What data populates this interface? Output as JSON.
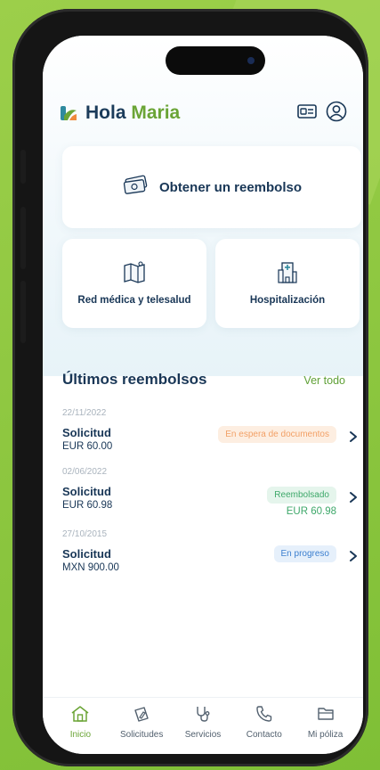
{
  "header": {
    "greeting": "Hola",
    "name": "Maria"
  },
  "actions": {
    "main": "Obtener un reembolso",
    "medical_network": "Red médica y telesalud",
    "hospitalization": "Hospitalización"
  },
  "reimbursements": {
    "title": "Últimos reembolsos",
    "see_all": "Ver todo",
    "items": [
      {
        "date": "22/11/2022",
        "title": "Solicitud",
        "amount": "EUR 60.00",
        "status": "En espera de documentos",
        "refund": ""
      },
      {
        "date": "02/06/2022",
        "title": "Solicitud",
        "amount": "EUR 60.98",
        "status": "Reembolsado",
        "refund": "EUR 60.98"
      },
      {
        "date": "27/10/2015",
        "title": "Solicitud",
        "amount": "MXN 900.00",
        "status": "En progreso",
        "refund": ""
      }
    ]
  },
  "nav": {
    "items": [
      {
        "label": "Inicio",
        "icon": "home-icon",
        "active": true
      },
      {
        "label": "Solicitudes",
        "icon": "document-pen-icon",
        "active": false
      },
      {
        "label": "Servicios",
        "icon": "stethoscope-icon",
        "active": false
      },
      {
        "label": "Contacto",
        "icon": "phone-icon",
        "active": false
      },
      {
        "label": "Mi póliza",
        "icon": "folder-icon",
        "active": false
      }
    ]
  },
  "colors": {
    "primary_dark": "#183656",
    "accent_green": "#6aa435",
    "status_waiting": "#f2a066",
    "status_refunded": "#3ea86a",
    "status_progress": "#3b7fcf",
    "background_green": "#8cc63f"
  }
}
